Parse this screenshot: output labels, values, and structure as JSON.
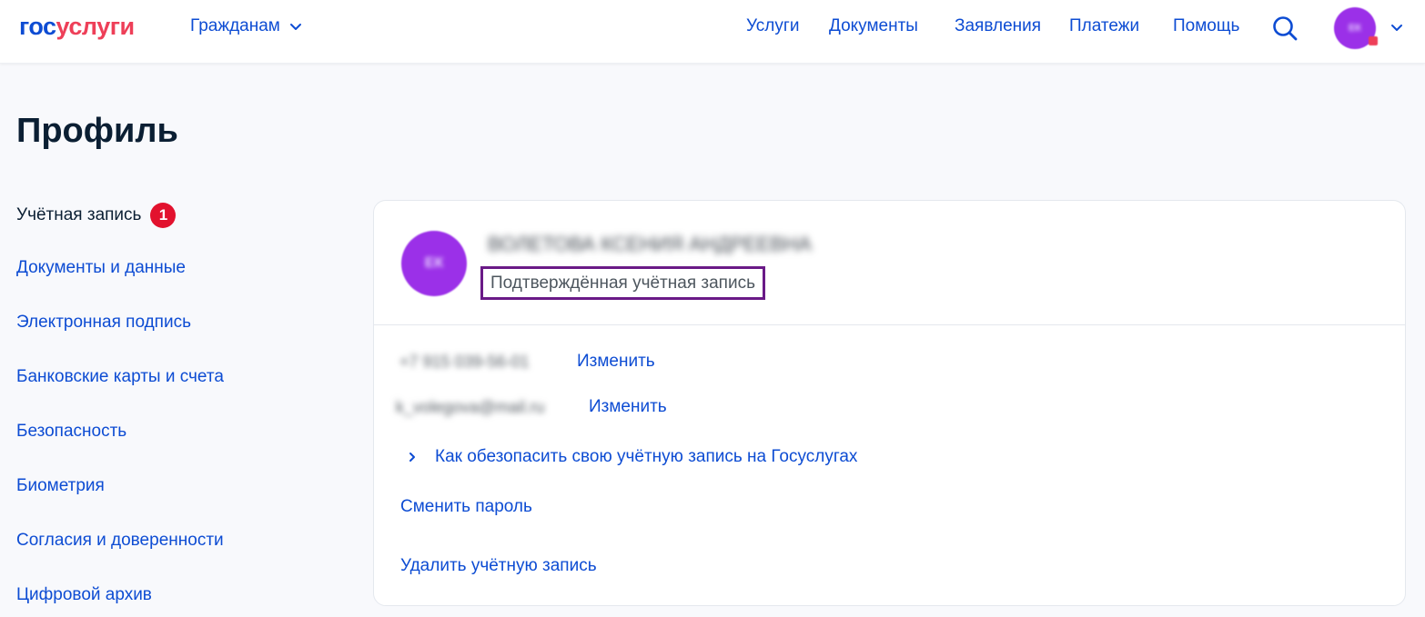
{
  "header": {
    "logo": {
      "part1": "гос",
      "part2": "услуги"
    },
    "audience_label": "Гражданам",
    "nav": [
      "Услуги",
      "Документы",
      "Заявления",
      "Платежи",
      "Помощь"
    ],
    "user_initials": "ЕК",
    "colors": {
      "brand_blue": "#0d4cd3",
      "brand_red": "#ee3f58",
      "avatar": "#9b30e8"
    }
  },
  "page": {
    "title": "Профиль"
  },
  "sidebar": {
    "items": [
      {
        "label": "Учётная запись",
        "badge": "1",
        "active": true
      },
      {
        "label": "Документы и данные"
      },
      {
        "label": "Электронная подпись"
      },
      {
        "label": "Банковские карты и счета"
      },
      {
        "label": "Безопасность"
      },
      {
        "label": "Биометрия"
      },
      {
        "label": "Согласия и доверенности"
      },
      {
        "label": "Цифровой архив"
      }
    ]
  },
  "card": {
    "user_initials": "ЕК",
    "user_name": "ВОЛЕТОВА КСЕНИЯ АНДРЕЕВНА",
    "verified_label": "Подтверждённая учётная запись",
    "phone": "+7 915 039-56-01",
    "email": "k_volegova@mail.ru",
    "change_label": "Изменить",
    "security_tips_label": "Как обезопасить свою учётную запись на Госуслугах",
    "change_password_label": "Сменить пароль",
    "delete_account_label": "Удалить учётную запись",
    "highlight_color": "#6a1a87"
  }
}
